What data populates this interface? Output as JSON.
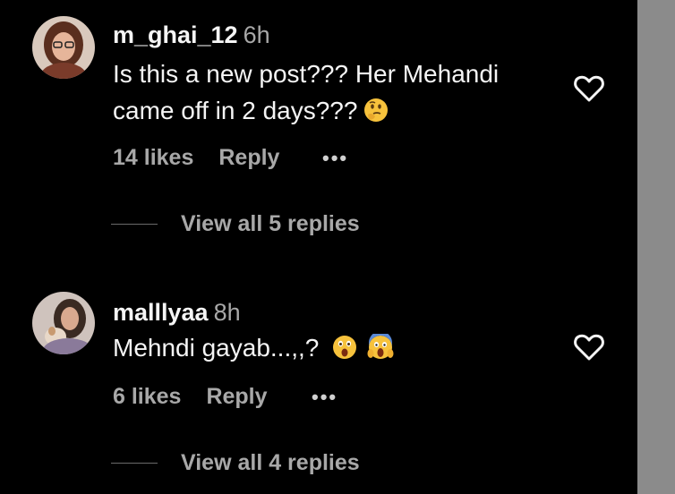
{
  "comments": [
    {
      "username": "m_ghai_12",
      "time": "6h",
      "text": "Is this a new post??? Her Mehandi came off in 2 days???",
      "emojis": [
        "thinking-face-emoji"
      ],
      "likes": "14 likes",
      "reply": "Reply",
      "more": "•••",
      "view_replies": "View all 5 replies"
    },
    {
      "username": "malllyaa",
      "time": "8h",
      "text": "Mehndi gayab...,,?",
      "emojis": [
        "astonished-face-emoji",
        "screaming-face-emoji"
      ],
      "likes": "6 likes",
      "reply": "Reply",
      "more": "•••",
      "view_replies": "View all 4 replies"
    }
  ],
  "colors": {
    "background": "#000000",
    "primary_text": "#f5f5f5",
    "secondary_text": "#a8a8a8",
    "scrollbar": "#8b8b8b"
  }
}
